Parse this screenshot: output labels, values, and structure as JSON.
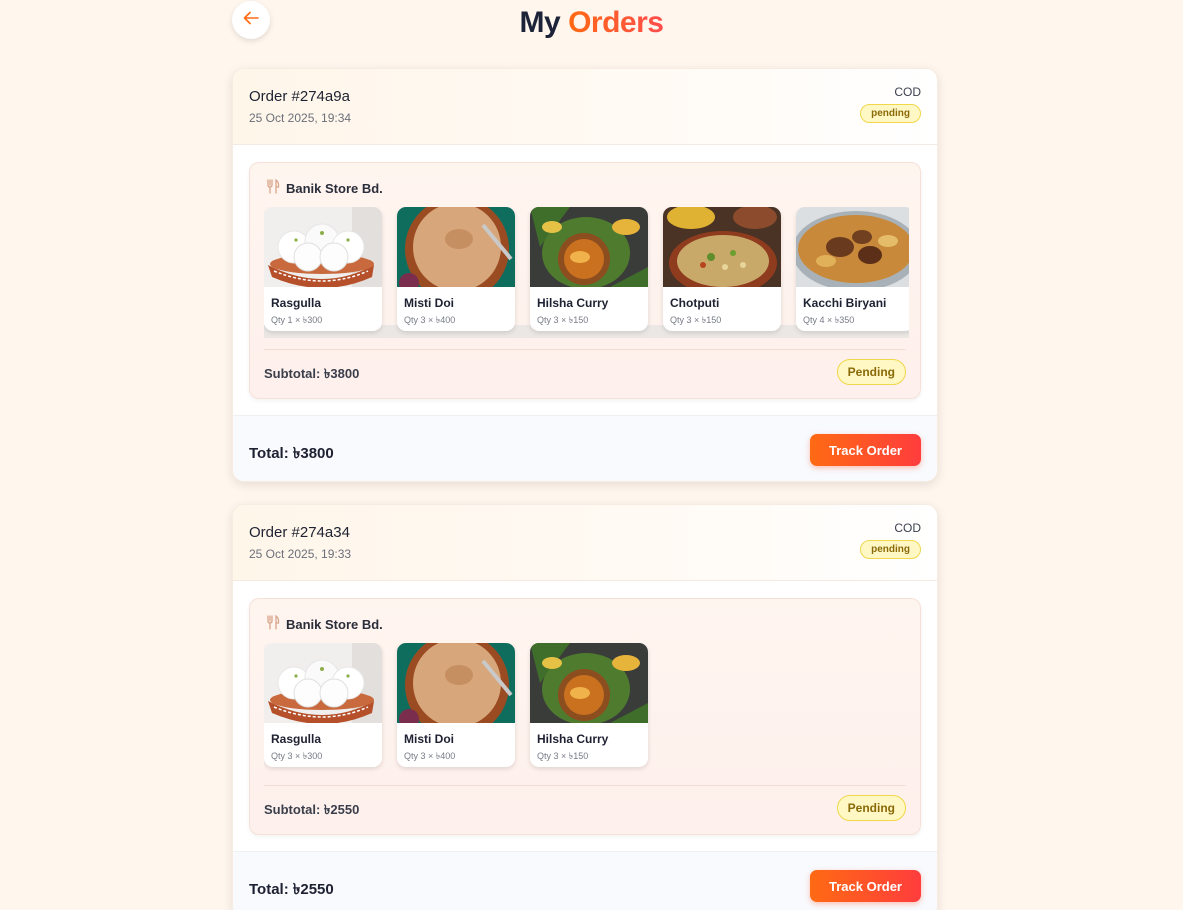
{
  "header": {
    "title_part1": "My",
    "title_part2": "Orders",
    "back_icon": "arrow-left-icon"
  },
  "colors": {
    "accent": "#ff6a13",
    "accent_end": "#ff3d3d",
    "pending_bg": "#fff7c4",
    "pending_border": "#f0d84a",
    "pending_text": "#8a6a08"
  },
  "orders": [
    {
      "id": "Order #274a9a",
      "date": "25 Oct 2025, 19:34",
      "payment": "COD",
      "status_small": "pending",
      "store": {
        "icon": "cutlery-icon",
        "name": "Banik Store Bd.",
        "items": [
          {
            "name": "Rasgulla",
            "qty": "Qty 1 × ৳300",
            "image": "rasgulla"
          },
          {
            "name": "Misti Doi",
            "qty": "Qty 3 × ৳400",
            "image": "misti-doi"
          },
          {
            "name": "Hilsha Curry",
            "qty": "Qty 3 × ৳150",
            "image": "hilsha-curry"
          },
          {
            "name": "Chotputi",
            "qty": "Qty 3 × ৳150",
            "image": "chotputi"
          },
          {
            "name": "Kacchi Biryani",
            "qty": "Qty 4 × ৳350",
            "image": "kacchi-biryani"
          }
        ],
        "subtotal": "Subtotal: ৳3800",
        "status": "Pending"
      },
      "total": "Total: ৳3800",
      "track_label": "Track Order"
    },
    {
      "id": "Order #274a34",
      "date": "25 Oct 2025, 19:33",
      "payment": "COD",
      "status_small": "pending",
      "store": {
        "icon": "cutlery-icon",
        "name": "Banik Store Bd.",
        "items": [
          {
            "name": "Rasgulla",
            "qty": "Qty 3 × ৳300",
            "image": "rasgulla"
          },
          {
            "name": "Misti Doi",
            "qty": "Qty 3 × ৳400",
            "image": "misti-doi"
          },
          {
            "name": "Hilsha Curry",
            "qty": "Qty 3 × ৳150",
            "image": "hilsha-curry"
          }
        ],
        "subtotal": "Subtotal: ৳2550",
        "status": "Pending"
      },
      "total": "Total: ৳2550",
      "track_label": "Track Order"
    }
  ]
}
